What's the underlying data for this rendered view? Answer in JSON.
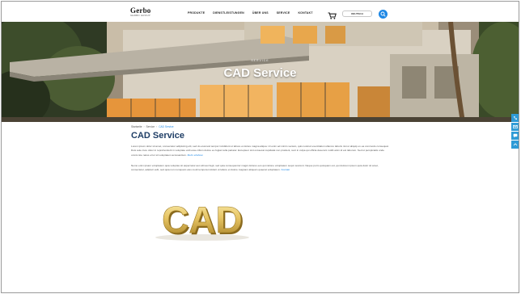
{
  "header": {
    "logo": "Gerbo",
    "logo_tagline": "GERBO GROUP",
    "nav": [
      "PRODUKTE",
      "DIENSTLEISTUNGEN",
      "ÜBER UNS",
      "SERVICE",
      "KONTAKT"
    ],
    "language_button": "Deutsch",
    "cart_icon": "cart-icon",
    "search_icon": "search-icon"
  },
  "hero": {
    "kicker": "SERVICE",
    "title": "CAD Service"
  },
  "breadcrumb": {
    "items": [
      "Startseite",
      "Service",
      "CAD Service"
    ]
  },
  "content": {
    "title": "CAD Service",
    "paragraph1": "Lorem ipsum dolor sit amet, consectetur adipiscing elit, sed do eiusmod tempor incididunt ut labore et dolore magna aliqua. Ut enim ad minim veniam, quis nostrud exercitation ullamco laboris nisi ut aliquip ex ea commodo consequat. Duis aute irure dolor in reprehenderit in voluptate velit esse cillum dolore eu fugiat nulla pariatur. Excepteur sint occaecat cupidatat non proident, sunt in culpa qui officia deserunt mollit anim id est laborum. Sed ut perspiciatis unde omnis iste natus error sit voluptatem accusantium.",
    "paragraph1_link": "Mehr erfahren",
    "paragraph2": "Nemo enim ipsam voluptatem quia voluptas sit aspernatur aut odit aut fugit, sed quia consequuntur magni dolores eos qui ratione voluptatem sequi nesciunt. Neque porro quisquam est, qui dolorem ipsum quia dolor sit amet, consectetur, adipisci velit, sed quia non numquam eius modi tempora incidunt ut labore et dolore magnam aliquam quaerat voluptatem.",
    "paragraph2_link": "Kontakt"
  },
  "image": {
    "text": "CAD",
    "color_light": "#f3dc8a",
    "color_dark": "#b8912e"
  },
  "side_buttons": [
    "phone-icon",
    "mail-icon",
    "chat-icon",
    "top-icon"
  ],
  "colors": {
    "accent": "#1e88e5",
    "title": "#1f3e66",
    "side": "#2e9bd6"
  }
}
